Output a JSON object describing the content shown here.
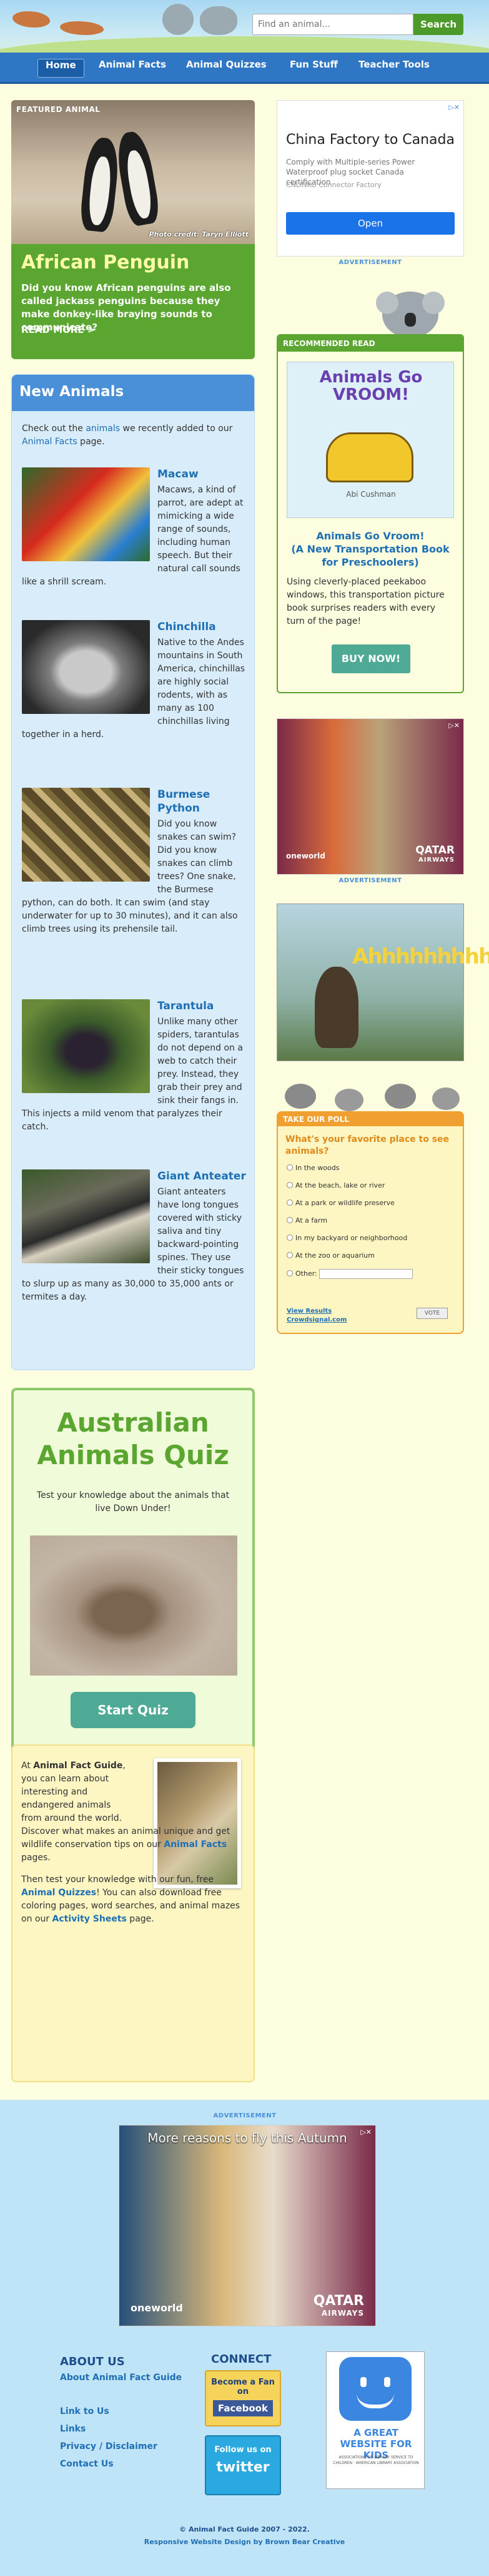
{
  "header": {
    "search_placeholder": "Find an animal...",
    "search_button": "Search"
  },
  "nav": [
    "Home",
    "Animal Facts",
    "Animal Quizzes",
    "Fun Stuff",
    "Teacher Tools"
  ],
  "featured": {
    "badge": "FEATURED ANIMAL",
    "credit": "Photo credit: Taryn Elliott",
    "title": "African Penguin",
    "text": "Did you know African penguins are also called jackass penguins because they make donkey-like braying sounds to communicate?",
    "more": "READ MORE >"
  },
  "new_animals": {
    "title": "New Animals",
    "intro_1": "Check out the ",
    "intro_link_1": "animals",
    "intro_2": " we recently added to our ",
    "intro_link_2": "Animal Facts",
    "intro_3": " page.",
    "items": [
      {
        "name": "Macaw",
        "text": "Macaws, a kind of parrot, are adept at mimicking a wide range of sounds, including human speech. But their natural call sounds like a shrill scream."
      },
      {
        "name": "Chinchilla",
        "text": "Native to the Andes mountains in South America, chinchillas are highly social rodents, with as many as 100 chinchillas living together in a herd."
      },
      {
        "name": "Burmese Python",
        "text": "Did you know snakes can swim? Did you know snakes can climb trees? One snake, the Burmese python, can do both. It can swim (and stay underwater for up to 30 minutes), and it can also climb trees using its prehensile tail."
      },
      {
        "name": "Tarantula",
        "text": "Unlike many other spiders, tarantulas do not depend on a web to catch their prey. Instead, they grab their prey and sink their fangs in. This injects a mild venom that paralyzes their catch."
      },
      {
        "name": "Giant Anteater",
        "text": "Giant anteaters have long tongues covered with sticky saliva and tiny backward-pointing spines. They use their sticky tongues to slurp up as many as 30,000 to 35,000 ants or termites a day."
      }
    ]
  },
  "quiz": {
    "title": "Australian Animals Quiz",
    "text": "Test your knowledge about the animals that live Down Under!",
    "button": "Start Quiz"
  },
  "about": {
    "p1_a": "At ",
    "p1_bold": "Animal Fact Guide",
    "p1_b": ", you can learn about interesting and endangered animals from around the world.",
    "p2_a": "Discover what makes an animal unique and get wildlife conservation tips on our ",
    "p2_link": "Animal Facts",
    "p2_b": " pages.",
    "p3_a": "Then test your knowledge with our fun, free ",
    "p3_link1": "Animal Quizzes",
    "p3_b": "! You can also download free coloring pages, word searches, and animal mazes on our ",
    "p3_link2": "Activity Sheets",
    "p3_c": " page."
  },
  "ad1": {
    "title": "China Factory to Canada",
    "sub": "Comply with Multiple-series Power Waterproof plug socket Canada certification",
    "sub2": "CNLINKO Connector Factory",
    "button": "Open"
  },
  "advertisement_label": "ADVERTISEMENT",
  "recommended": {
    "header": "RECOMMENDED READ",
    "cover_title": "Animals Go VROOM!",
    "cover_author": "Abi Cushman",
    "book_title": "Animals Go Vroom!",
    "book_subtitle": "(A New Transportation Book for Preschoolers)",
    "text": "Using cleverly-placed peekaboo windows, this transportation picture book surprises readers with every turn of the page!",
    "button": "BUY NOW!"
  },
  "ad2": {
    "logo": "oneworld",
    "brand": "QATAR",
    "brand_sub": "AIRWAYS"
  },
  "promo": {
    "text": "Ahhhhhhhhh"
  },
  "poll": {
    "header": "TAKE OUR POLL",
    "question": "What's your favorite place to see animals?",
    "options": [
      "In the woods",
      "At the beach, lake or river",
      "At a park or wildlife preserve",
      "At a farm",
      "In my backyard or neighborhood",
      "At the zoo or aquarium",
      "Other:"
    ],
    "results": "View Results",
    "crowd": "Crowdsignal.com",
    "vote": "VOTE"
  },
  "ad3": {
    "title": "More reasons to fly this Autumn",
    "logo": "oneworld",
    "brand": "QATAR",
    "brand_sub": "AIRWAYS"
  },
  "footer": {
    "about_title": "ABOUT US",
    "connect_title": "CONNECT",
    "links": [
      "About Animal Fact Guide",
      "Link to Us",
      "Links",
      "Privacy / Disclaimer",
      "Contact Us"
    ],
    "fb_text": "Become a Fan on",
    "fb_brand": "Facebook",
    "tw_text": "Follow us on",
    "tw_brand": "twitter",
    "kids_title": "A GREAT WEBSITE FOR KIDS",
    "kids_sub": "ASSOCIATION FOR LIBRARY SERVICE TO CHILDREN · AMERICAN LIBRARY ASSOCIATION",
    "copyright": "© Animal Fact Guide 2007 - 2022.",
    "credit": "Responsive Website Design by Brown Bear Creative"
  }
}
